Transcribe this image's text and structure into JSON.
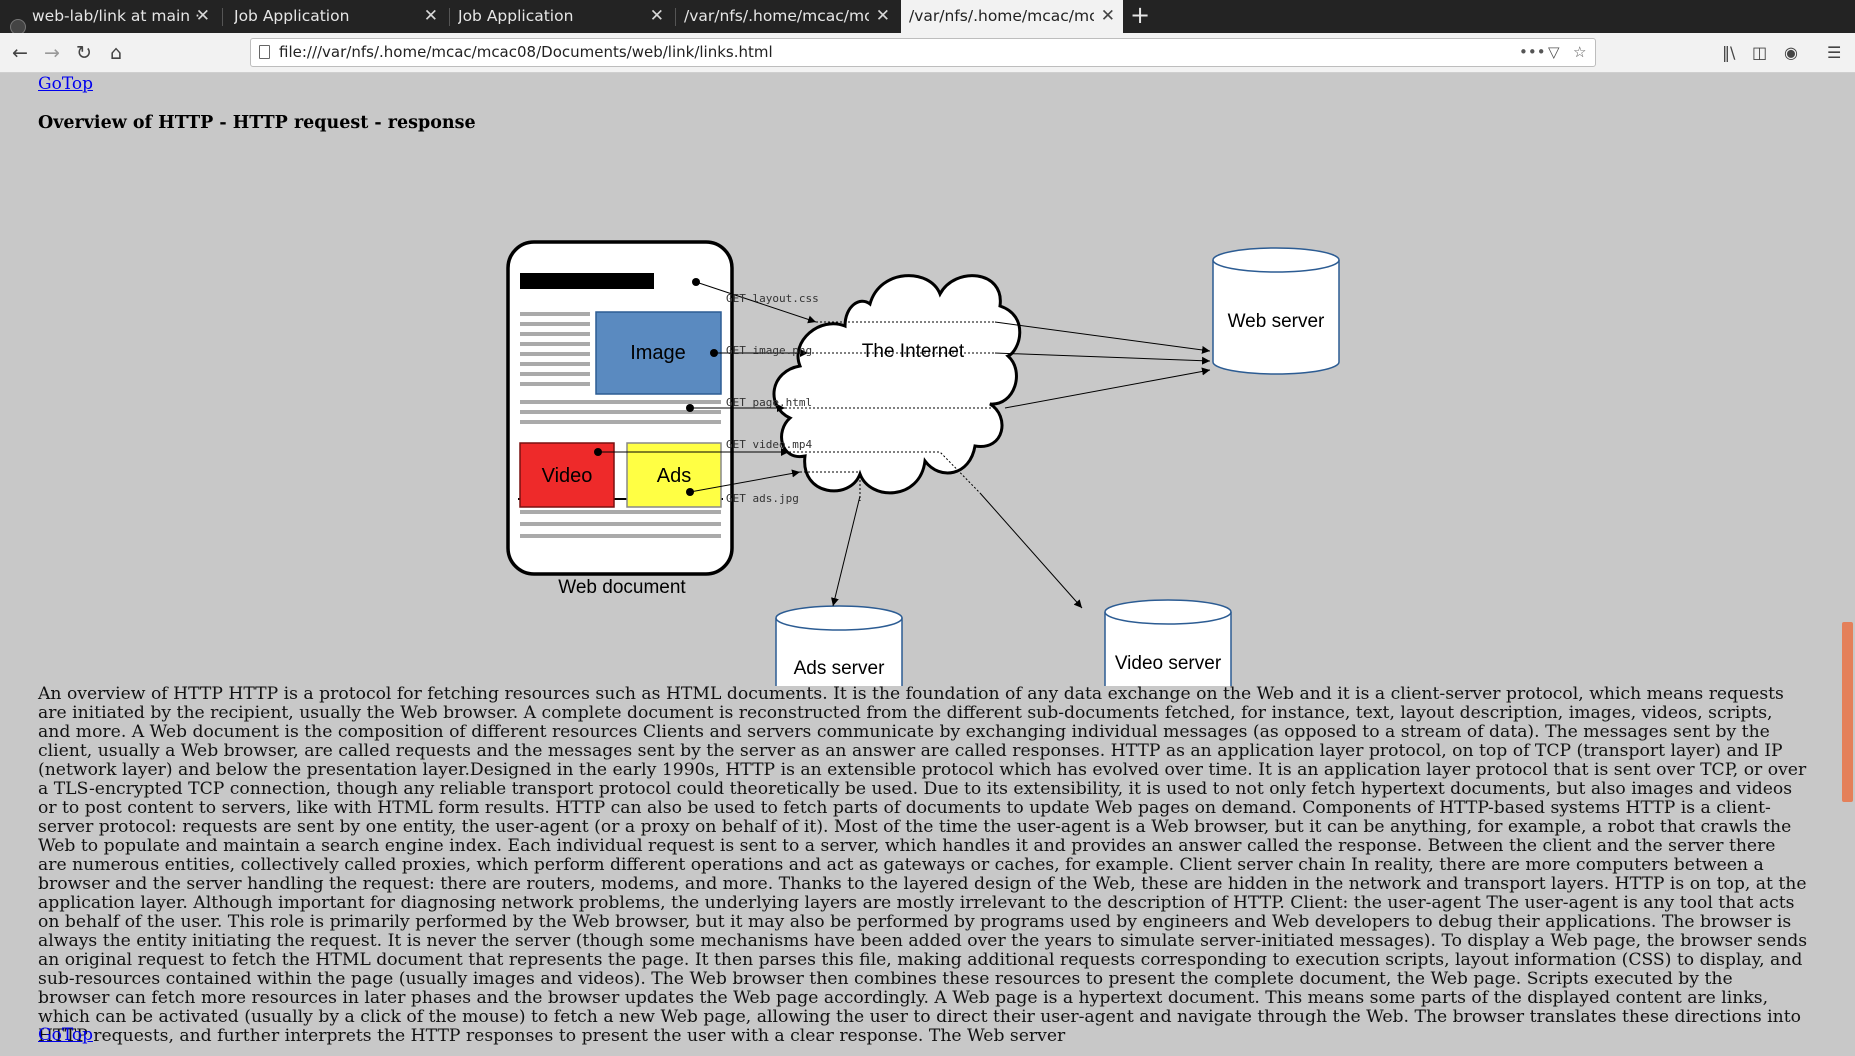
{
  "tabs": [
    {
      "label": "web-lab/link at main · ad",
      "icon": "github-icon",
      "active": false
    },
    {
      "label": "Job Application",
      "active": false
    },
    {
      "label": "Job Application",
      "active": false
    },
    {
      "label": "/var/nfs/.home/mcac/mcac",
      "active": false
    },
    {
      "label": "/var/nfs/.home/mcac/mcac",
      "active": true
    }
  ],
  "navbar": {
    "url": "file:///var/nfs/.home/mcac/mcac08/Documents/web/link/links.html"
  },
  "page": {
    "gotop_top": "GoTop",
    "heading": "Overview of HTTP - HTTP request - response",
    "diagram": {
      "web_document_label": "Web document",
      "image_label": "Image",
      "video_label": "Video",
      "ads_label": "Ads",
      "internet_label": "The Internet",
      "web_server_label": "Web server",
      "ads_server_label": "Ads server",
      "video_server_label": "Video server",
      "req_layout": "GET layout.css",
      "req_image": "GET image.png",
      "req_page": "GET page.html",
      "req_video": "GET video.mp4",
      "req_ads": "GET ads.jpg"
    },
    "paragraph": "An overview of HTTP HTTP is a protocol for fetching resources such as HTML documents. It is the foundation of any data exchange on the Web and it is a client-server protocol, which means requests are initiated by the recipient, usually the Web browser. A complete document is reconstructed from the different sub-documents fetched, for instance, text, layout description, images, videos, scripts, and more. A Web document is the composition of different resources Clients and servers communicate by exchanging individual messages (as opposed to a stream of data). The messages sent by the client, usually a Web browser, are called requests and the messages sent by the server as an answer are called responses. HTTP as an application layer protocol, on top of TCP (transport layer) and IP (network layer) and below the presentation layer.Designed in the early 1990s, HTTP is an extensible protocol which has evolved over time. It is an application layer protocol that is sent over TCP, or over a TLS-encrypted TCP connection, though any reliable transport protocol could theoretically be used. Due to its extensibility, it is used to not only fetch hypertext documents, but also images and videos or to post content to servers, like with HTML form results. HTTP can also be used to fetch parts of documents to update Web pages on demand. Components of HTTP-based systems HTTP is a client-server protocol: requests are sent by one entity, the user-agent (or a proxy on behalf of it). Most of the time the user-agent is a Web browser, but it can be anything, for example, a robot that crawls the Web to populate and maintain a search engine index. Each individual request is sent to a server, which handles it and provides an answer called the response. Between the client and the server there are numerous entities, collectively called proxies, which perform different operations and act as gateways or caches, for example. Client server chain In reality, there are more computers between a browser and the server handling the request: there are routers, modems, and more. Thanks to the layered design of the Web, these are hidden in the network and transport layers. HTTP is on top, at the application layer. Although important for diagnosing network problems, the underlying layers are mostly irrelevant to the description of HTTP. Client: the user-agent The user-agent is any tool that acts on behalf of the user. This role is primarily performed by the Web browser, but it may also be performed by programs used by engineers and Web developers to debug their applications. The browser is always the entity initiating the request. It is never the server (though some mechanisms have been added over the years to simulate server-initiated messages). To display a Web page, the browser sends an original request to fetch the HTML document that represents the page. It then parses this file, making additional requests corresponding to execution scripts, layout information (CSS) to display, and sub-resources contained within the page (usually images and videos). The Web browser then combines these resources to present the complete document, the Web page. Scripts executed by the browser can fetch more resources in later phases and the browser updates the Web page accordingly. A Web page is a hypertext document. This means some parts of the displayed content are links, which can be activated (usually by a click of the mouse) to fetch a new Web page, allowing the user to direct their user-agent and navigate through the Web. The browser translates these directions into HTTP requests, and further interprets the HTTP responses to present the user with a clear response. The Web server",
    "gotop_bottom": "GoTop"
  },
  "colors": {
    "page_bg": "#c8c8c8",
    "image_box": "#5a8ac0",
    "video_box": "#ee2a2a",
    "ads_box": "#ffff44",
    "link": "#0000ee",
    "scroll_thumb": "#e4805a"
  }
}
